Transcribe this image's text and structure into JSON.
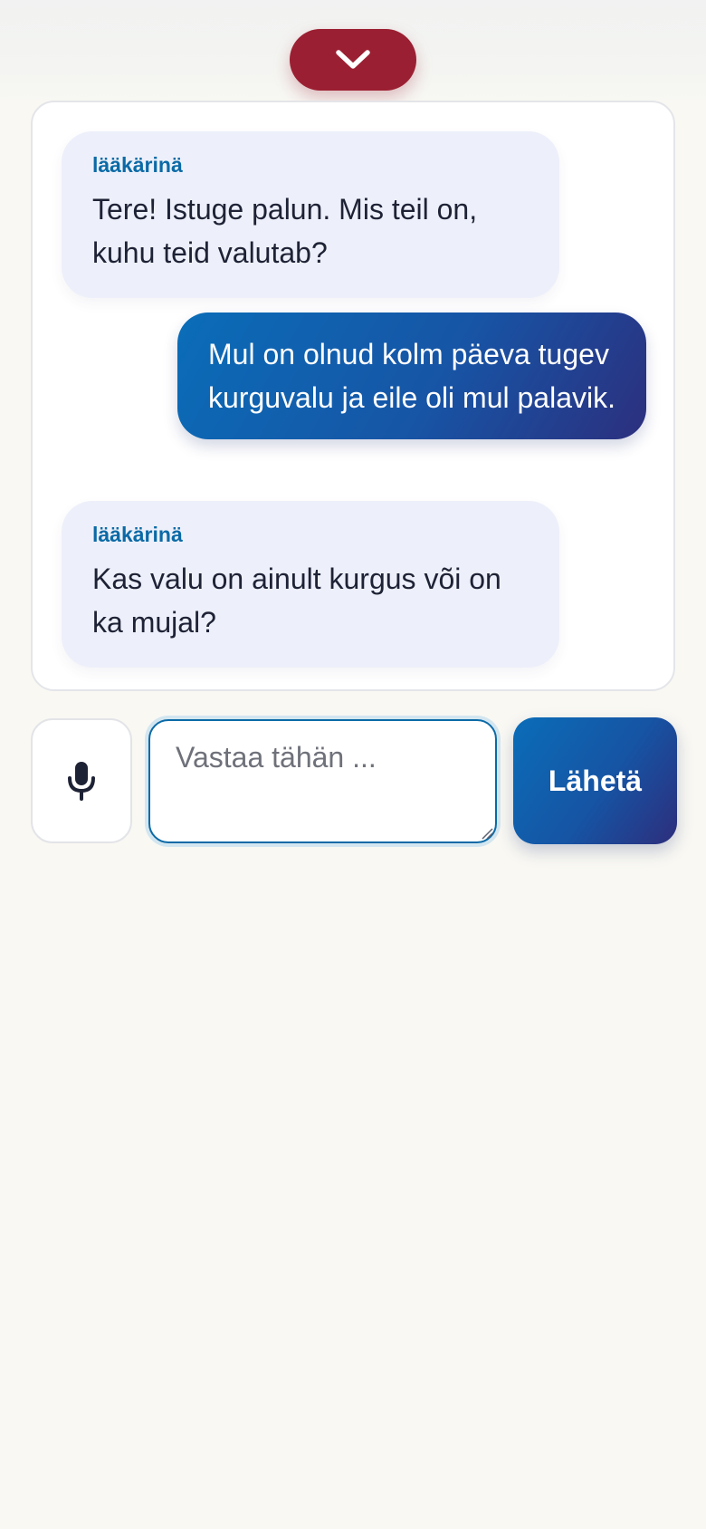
{
  "header": {
    "collapse_icon": "chevron-down-icon",
    "accent_color": "#9b1f32"
  },
  "chat": {
    "messages": [
      {
        "role": "doctor",
        "sender": "lääkärinä",
        "text": "Tere! Istuge palun. Mis teil on, kuhu teid valutab?"
      },
      {
        "role": "patient",
        "text": "Mul on olnud kolm päeva tugev kurguvalu ja eile oli mul palavik."
      },
      {
        "role": "doctor",
        "sender": "lääkärinä",
        "text": "Kas valu on ainult kurgus või on ka mujal?"
      }
    ]
  },
  "composer": {
    "mic_icon": "microphone-icon",
    "reply_value": "",
    "reply_placeholder": "Vastaa tähän ...",
    "send_label": "Lähetä",
    "brand_blue": "#0b6aa6"
  }
}
